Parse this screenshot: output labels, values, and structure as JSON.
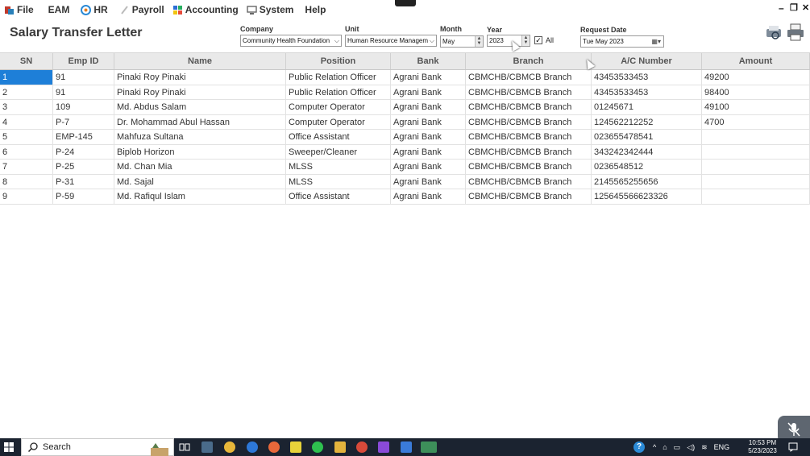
{
  "menu": {
    "items": [
      {
        "label": "File",
        "icon": "file-app-icon",
        "color": "#c0392b"
      },
      {
        "label": "EAM",
        "icon": "",
        "color": ""
      },
      {
        "label": "HR",
        "icon": "hr-icon",
        "color": "#2b8ad6"
      },
      {
        "label": "Payroll",
        "icon": "payroll-icon",
        "color": "#bbbbbb"
      },
      {
        "label": "Accounting",
        "icon": "accounting-icon",
        "color": "#2c6ed5"
      },
      {
        "label": "System",
        "icon": "system-icon",
        "color": "#777777"
      },
      {
        "label": "Help",
        "icon": "",
        "color": ""
      }
    ],
    "window_minimize": "–",
    "window_restore": "❐",
    "window_close": "✕"
  },
  "page": {
    "title": "Salary Transfer Letter"
  },
  "filters": {
    "company_label": "Company",
    "company_value": "Community Health Foundation",
    "unit_label": "Unit",
    "unit_value": "Human Resource Managem",
    "month_label": "Month",
    "month_value": "May",
    "year_label": "Year",
    "year_value": "2023",
    "all_label": "All",
    "all_checked": true,
    "request_date_label": "Request Date",
    "request_date_value": "Tue  May 2023"
  },
  "grid": {
    "columns": [
      "SN",
      "Emp ID",
      "Name",
      "Position",
      "Bank",
      "Branch",
      "A/C Number",
      "Amount"
    ],
    "rows": [
      [
        "1",
        "91",
        "Pinaki Roy Pinaki",
        "Public Relation Officer",
        "Agrani Bank",
        "CBMCHB/CBMCB Branch",
        "43453533453",
        "49200"
      ],
      [
        "2",
        "91",
        "Pinaki Roy Pinaki",
        "Public Relation Officer",
        "Agrani Bank",
        "CBMCHB/CBMCB Branch",
        "43453533453",
        "98400"
      ],
      [
        "3",
        "109",
        "Md. Abdus Salam",
        "Computer Operator",
        "Agrani Bank",
        "CBMCHB/CBMCB Branch",
        "01245671",
        "49100"
      ],
      [
        "4",
        "P-7",
        "Dr. Mohammad Abul Hassan",
        "Computer Operator",
        "Agrani Bank",
        "CBMCHB/CBMCB Branch",
        "124562212252",
        "4700"
      ],
      [
        "5",
        "EMP-145",
        "Mahfuza Sultana",
        "Office Assistant",
        "Agrani Bank",
        "CBMCHB/CBMCB Branch",
        "023655478541",
        ""
      ],
      [
        "6",
        "P-24",
        "Biplob Horizon",
        "Sweeper/Cleaner",
        "Agrani Bank",
        "CBMCHB/CBMCB Branch",
        "343242342444",
        ""
      ],
      [
        "7",
        "P-25",
        "Md. Chan Mia",
        "MLSS",
        "Agrani Bank",
        "CBMCHB/CBMCB Branch",
        "0236548512",
        ""
      ],
      [
        "8",
        "P-31",
        "Md. Sajal",
        "MLSS",
        "Agrani Bank",
        "CBMCHB/CBMCB Branch",
        "2145565255656",
        ""
      ],
      [
        "9",
        "P-59",
        "Md. Rafiqul Islam",
        "Office Assistant",
        "Agrani Bank",
        "CBMCHB/CBMCB Branch",
        "125645566623326",
        ""
      ]
    ],
    "selected_color": "#1e7fd8"
  },
  "taskbar": {
    "search_placeholder": "Search",
    "language": "ENG",
    "time": "10:53 PM",
    "date": "5/23/2023"
  }
}
